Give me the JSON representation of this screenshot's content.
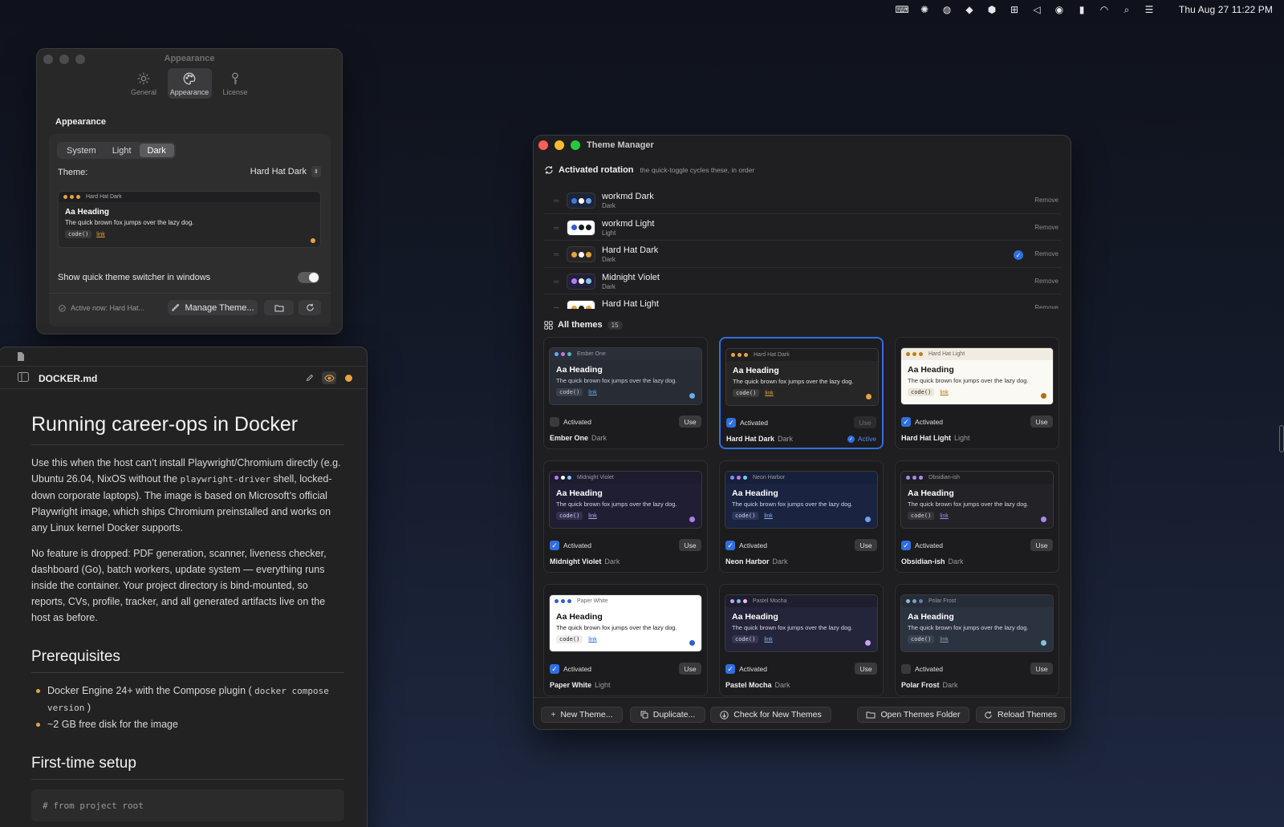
{
  "menubar": {
    "clock": "Thu Aug 27  11:22 PM",
    "icons": [
      "terminal-icon",
      "sparkle-icon",
      "globe-icon",
      "dropbox-icon",
      "box-icon",
      "network-icon",
      "megaphone-icon",
      "user-circle-icon",
      "bar-chart-icon",
      "wifi-icon",
      "search-icon",
      "control-center-icon"
    ]
  },
  "appearance": {
    "window_title": "Appearance",
    "tabs": [
      {
        "label": "General",
        "icon": "gear-icon"
      },
      {
        "label": "Appearance",
        "icon": "palette-icon"
      },
      {
        "label": "License",
        "icon": "key-icon"
      }
    ],
    "selected_tab": "Appearance",
    "section_title": "Appearance",
    "mode_options": [
      "System",
      "Light",
      "Dark"
    ],
    "mode_selected": "Dark",
    "theme_label": "Theme:",
    "theme_value": "Hard Hat Dark",
    "preview": {
      "name": "Hard Hat Dark",
      "heading": "Aa Heading",
      "text": "The quick brown fox jumps over the lazy dog.",
      "code": "code()",
      "link": "link",
      "dots": [
        "#e8a33d",
        "#e8a33d",
        "#e8a33d"
      ],
      "accent": "#e8a33d"
    },
    "switcher_label": "Show quick theme switcher in windows",
    "switcher_on": true,
    "active_now": "Active now: Hard Hat...",
    "manage_button": "Manage Theme..."
  },
  "editor": {
    "filename": "DOCKER.md",
    "h1": "Running career-ops in Docker",
    "p1_a": "Use this when the host can’t install Playwright/Chromium directly (e.g. Ubuntu 26.04, NixOS without the ",
    "p1_code": "playwright-driver",
    "p1_b": " shell, locked-down corporate laptops). The image is based on Microsoft’s official Playwright image, which ships Chromium preinstalled and works on any Linux kernel Docker supports.",
    "p2": "No feature is dropped: PDF generation, scanner, liveness checker, dashboard (Go), batch workers, update system — everything runs inside the container. Your project directory is bind-mounted, so reports, CVs, profile, tracker, and all generated artifacts live on the host as before.",
    "h2_prereq": "Prerequisites",
    "li1_a": "Docker Engine 24+ with the Compose plugin ( ",
    "li1_code": "docker compose version",
    "li1_b": " )",
    "li2": "~2 GB free disk for the image",
    "h2_setup": "First-time setup",
    "code_line": "# from project root"
  },
  "theme_manager": {
    "window_title": "Theme Manager",
    "rotation_title": "Activated rotation",
    "rotation_sub": "the quick-toggle cycles these, in order",
    "remove_label": "Remove",
    "rotation": [
      {
        "name": "workmd Dark",
        "mode": "Dark",
        "bg": "#ffffff",
        "dots": [
          "#3f7be0",
          "#ffffff",
          "#6aa2f2"
        ],
        "swbg": "#1d2436",
        "current": false
      },
      {
        "name": "workmd Light",
        "mode": "Light",
        "bg": "#ffffff",
        "dots": [
          "#2d5ed0",
          "#1a1a1a",
          "#1a1a1a"
        ],
        "swbg": "#ffffff",
        "current": false
      },
      {
        "name": "Hard Hat Dark",
        "mode": "Dark",
        "dots": [
          "#e8a33d",
          "#ffffff",
          "#e8a33d"
        ],
        "swbg": "#262626",
        "current": true
      },
      {
        "name": "Midnight Violet",
        "mode": "Dark",
        "dots": [
          "#b07ef0",
          "#ffffff",
          "#7ec8f0"
        ],
        "swbg": "#22203a",
        "current": false
      },
      {
        "name": "Hard Hat Light",
        "mode": "Light",
        "dots": [
          "#e8a33d",
          "#1a1a1a",
          "#e8a33d"
        ],
        "swbg": "#ffffff",
        "current": false
      }
    ],
    "all_title": "All themes",
    "all_count": "15",
    "activated_label": "Activated",
    "use_label": "Use",
    "active_label": "Active",
    "themes": [
      {
        "name": "Ember One",
        "mode": "Dark",
        "activated": false,
        "active": false,
        "bar": "#2b2f38",
        "body": "#282c34",
        "fg": "#ffffff",
        "sub": "#c8ccd4",
        "dots": [
          "#61afef",
          "#c678dd",
          "#56b6c2"
        ],
        "chip": "#3a3f4b",
        "link": "#61afef",
        "accent": "#61afef"
      },
      {
        "name": "Hard Hat Dark",
        "mode": "Dark",
        "activated": true,
        "active": true,
        "bar": "#1f1f21",
        "body": "#262626",
        "fg": "#ffffff",
        "sub": "#e0e0e0",
        "dots": [
          "#e8a33d",
          "#e8a33d",
          "#e8a33d"
        ],
        "chip": "#3a3a3a",
        "link": "#e8a33d",
        "accent": "#e8a33d"
      },
      {
        "name": "Hard Hat Light",
        "mode": "Light",
        "activated": true,
        "active": false,
        "bar": "#f0ece2",
        "body": "#fbf9f4",
        "fg": "#1a1a1a",
        "sub": "#333333",
        "dots": [
          "#c27c1a",
          "#c27c1a",
          "#c27c1a"
        ],
        "chip": "#ebe6da",
        "link": "#b06f10",
        "accent": "#b06f10"
      },
      {
        "name": "Midnight Violet",
        "mode": "Dark",
        "activated": true,
        "active": false,
        "bar": "#1d1b2e",
        "body": "#201e33",
        "fg": "#ffffff",
        "sub": "#d6d2ee",
        "dots": [
          "#b07ef0",
          "#ffffff",
          "#7ec8f0"
        ],
        "chip": "#34304f",
        "link": "#b9a4f5",
        "accent": "#b07ef0"
      },
      {
        "name": "Neon Harbor",
        "mode": "Dark",
        "activated": true,
        "active": false,
        "bar": "#17203a",
        "body": "#1a2340",
        "fg": "#ffffff",
        "sub": "#cfd6ee",
        "dots": [
          "#7e8cf0",
          "#c678dd",
          "#7ec8f0"
        ],
        "chip": "#2c3658",
        "link": "#8fb0f5",
        "accent": "#6aa2f2"
      },
      {
        "name": "Obsidian-ish",
        "mode": "Dark",
        "activated": true,
        "active": false,
        "bar": "#1e1e22",
        "body": "#232327",
        "fg": "#ffffff",
        "sub": "#d8d8dc",
        "dots": [
          "#a88af0",
          "#a88af0",
          "#a88af0"
        ],
        "chip": "#35353a",
        "link": "#a88af0",
        "accent": "#a88af0"
      },
      {
        "name": "Paper White",
        "mode": "Light",
        "activated": true,
        "active": false,
        "bar": "#ffffff",
        "body": "#ffffff",
        "fg": "#111111",
        "sub": "#222222",
        "dots": [
          "#2d5ed0",
          "#2d5ed0",
          "#2d5ed0"
        ],
        "chip": "#eeeeee",
        "link": "#2d5ed0",
        "accent": "#2d5ed0"
      },
      {
        "name": "Pastel Mocha",
        "mode": "Dark",
        "activated": true,
        "active": false,
        "bar": "#1e1e2e",
        "body": "#24243a",
        "fg": "#ffffff",
        "sub": "#d9d6f0",
        "dots": [
          "#c9a4f5",
          "#89b4fa",
          "#f5c2e7"
        ],
        "chip": "#363650",
        "link": "#89b4fa",
        "accent": "#c9a4f5"
      },
      {
        "name": "Polar Frost",
        "mode": "Dark",
        "activated": false,
        "active": false,
        "bar": "#262c38",
        "body": "#2b3240",
        "fg": "#ffffff",
        "sub": "#d5dae4",
        "dots": [
          "#88c0d0",
          "#81a1c1",
          "#5e81ac"
        ],
        "chip": "#3b4252",
        "link": "#81a1c1",
        "accent": "#88c0d0"
      }
    ],
    "preview_heading": "Aa Heading",
    "preview_text": "The quick brown fox jumps over the lazy dog.",
    "preview_code": "code()",
    "preview_link": "link",
    "footer": {
      "new_theme": "New Theme...",
      "duplicate": "Duplicate...",
      "check": "Check for New Themes",
      "open_folder": "Open Themes Folder",
      "reload": "Reload Themes"
    }
  }
}
